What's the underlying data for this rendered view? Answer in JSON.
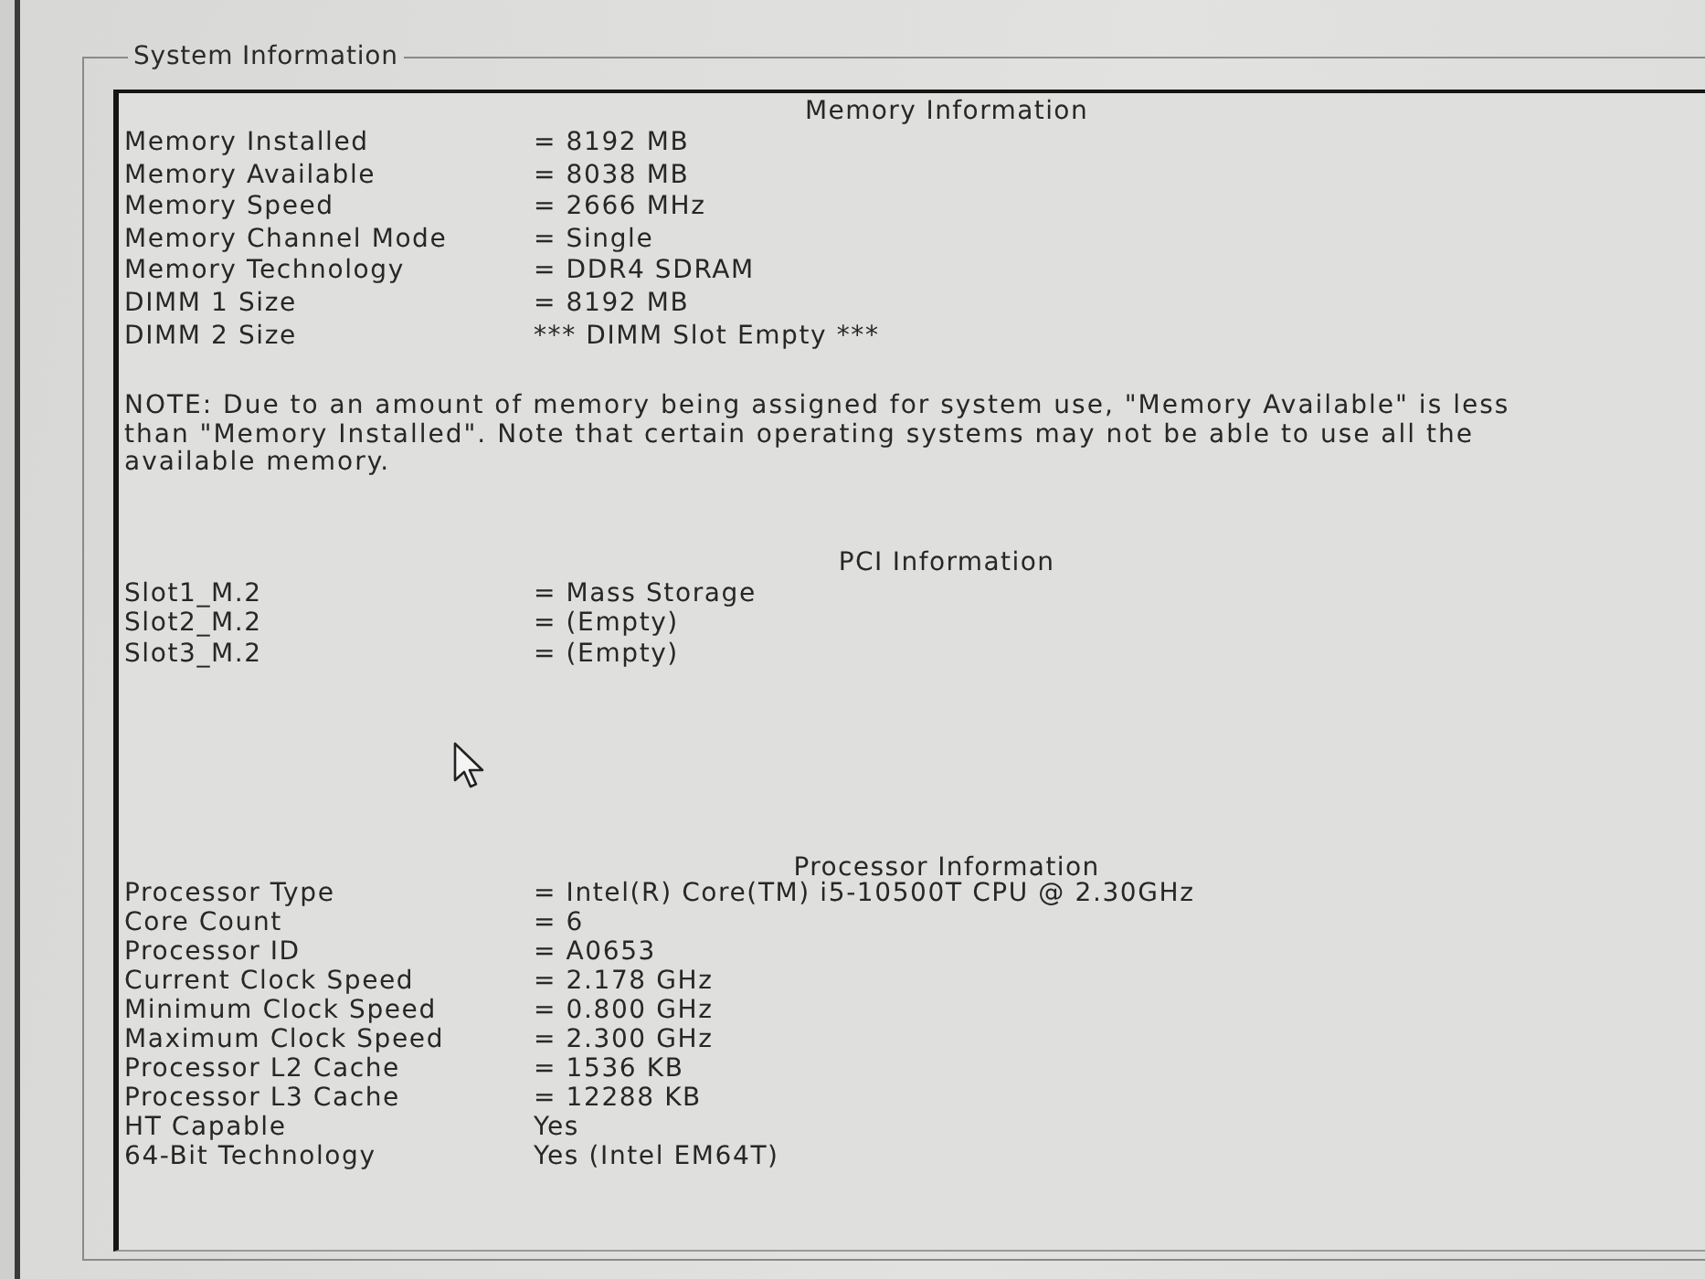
{
  "group_box": {
    "title": "System Information"
  },
  "sections": [
    {
      "heading": "Memory Information",
      "rows": [
        {
          "label": "Memory Installed",
          "value": "= 8192 MB"
        },
        {
          "label": "Memory Available",
          "value": "= 8038 MB"
        },
        {
          "label": "Memory Speed",
          "value": "= 2666 MHz"
        },
        {
          "label": "Memory Channel Mode",
          "value": "= Single"
        },
        {
          "label": "Memory Technology",
          "value": "= DDR4 SDRAM"
        },
        {
          "label": "DIMM 1 Size",
          "value": "= 8192 MB"
        },
        {
          "label": "DIMM 2 Size",
          "value": "*** DIMM Slot Empty ***"
        }
      ],
      "note": "NOTE: Due to an amount of memory being assigned for system use, \"Memory Available\" is less than \"Memory Installed\". Note that certain operating systems may not be able to use all the available memory."
    },
    {
      "heading": "PCI Information",
      "rows": [
        {
          "label": "Slot1_M.2",
          "value": "= Mass Storage"
        },
        {
          "label": "Slot2_M.2",
          "value": "= (Empty)"
        },
        {
          "label": "Slot3_M.2",
          "value": "= (Empty)"
        }
      ]
    },
    {
      "heading": "Processor Information",
      "rows": [
        {
          "label": "Processor Type",
          "value": "= Intel(R) Core(TM) i5-10500T CPU @ 2.30GHz"
        },
        {
          "label": "Core Count",
          "value": "= 6"
        },
        {
          "label": "Processor ID",
          "value": "= A0653"
        },
        {
          "label": "Current Clock Speed",
          "value": "= 2.178 GHz"
        },
        {
          "label": "Minimum Clock Speed",
          "value": "= 0.800 GHz"
        },
        {
          "label": "Maximum Clock Speed",
          "value": "= 2.300 GHz"
        },
        {
          "label": "Processor L2 Cache",
          "value": "= 1536 KB"
        },
        {
          "label": "Processor L3 Cache",
          "value": "= 12288 KB"
        },
        {
          "label": "HT Capable",
          "value": "Yes"
        },
        {
          "label": "64-Bit Technology",
          "value": "Yes (Intel EM64T)"
        }
      ]
    }
  ]
}
